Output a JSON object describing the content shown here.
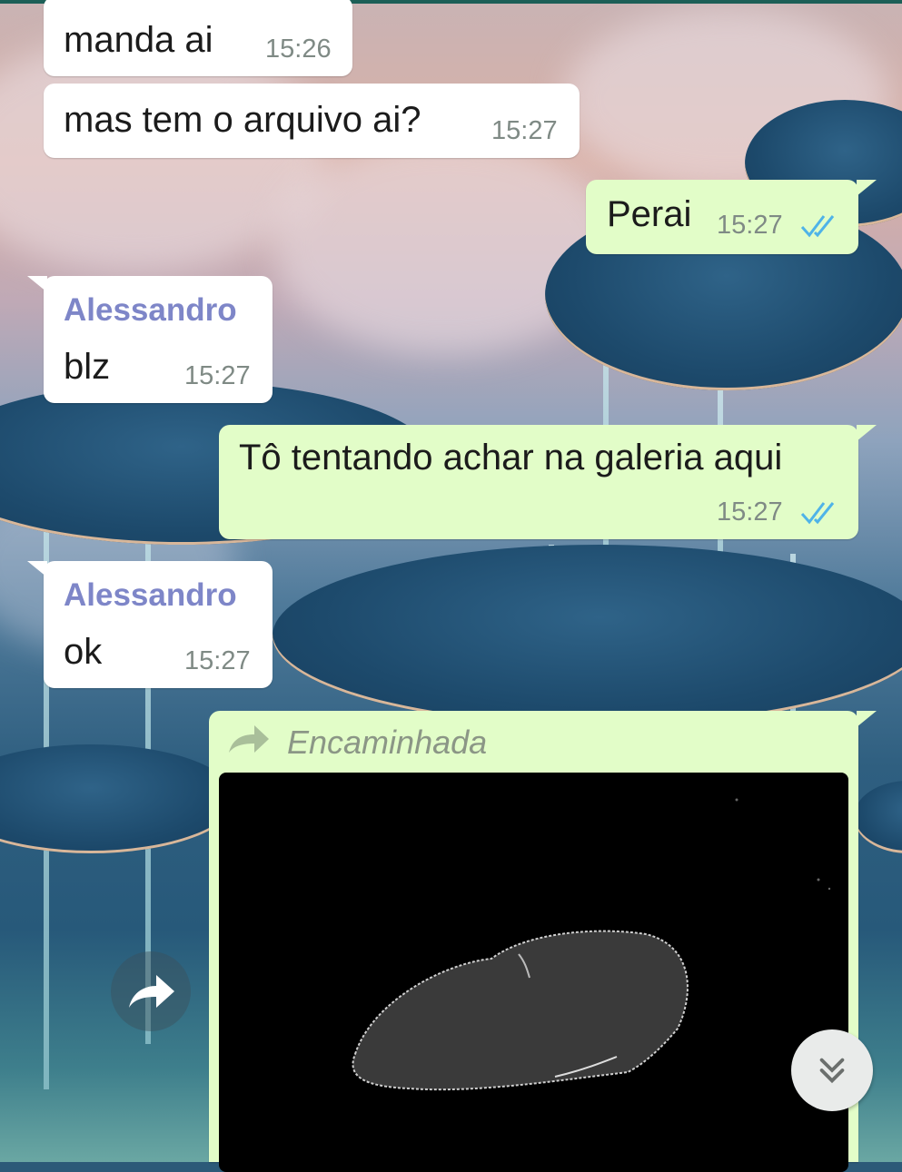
{
  "messages": [
    {
      "id": "m1",
      "direction": "in",
      "text": "manda ai",
      "time": "15:26"
    },
    {
      "id": "m2",
      "direction": "in",
      "text": "mas tem o arquivo ai?",
      "time": "15:27"
    },
    {
      "id": "m3",
      "direction": "out",
      "text": "Perai",
      "time": "15:27",
      "status": "read"
    },
    {
      "id": "m4",
      "direction": "in",
      "sender": "Alessandro",
      "text": "blz",
      "time": "15:27"
    },
    {
      "id": "m5",
      "direction": "out",
      "text": "Tô tentando achar na galeria aqui",
      "time": "15:27",
      "status": "read"
    },
    {
      "id": "m6",
      "direction": "in",
      "sender": "Alessandro",
      "text": "ok",
      "time": "15:27"
    },
    {
      "id": "m7",
      "direction": "out",
      "forwarded_label": "Encaminhada",
      "type": "image"
    }
  ],
  "icons": {
    "forward": "forward-arrow-icon",
    "read_ticks": "double-check-icon",
    "share": "share-forward-icon",
    "scroll_down": "double-chevron-down-icon"
  },
  "colors": {
    "incoming_bubble": "#ffffff",
    "outgoing_bubble": "#e2fdc8",
    "sender_name": "#7e86c8",
    "read_ticks": "#4fb3e8",
    "timestamp": "#7f8a85",
    "header_bar": "#1c5f57"
  }
}
